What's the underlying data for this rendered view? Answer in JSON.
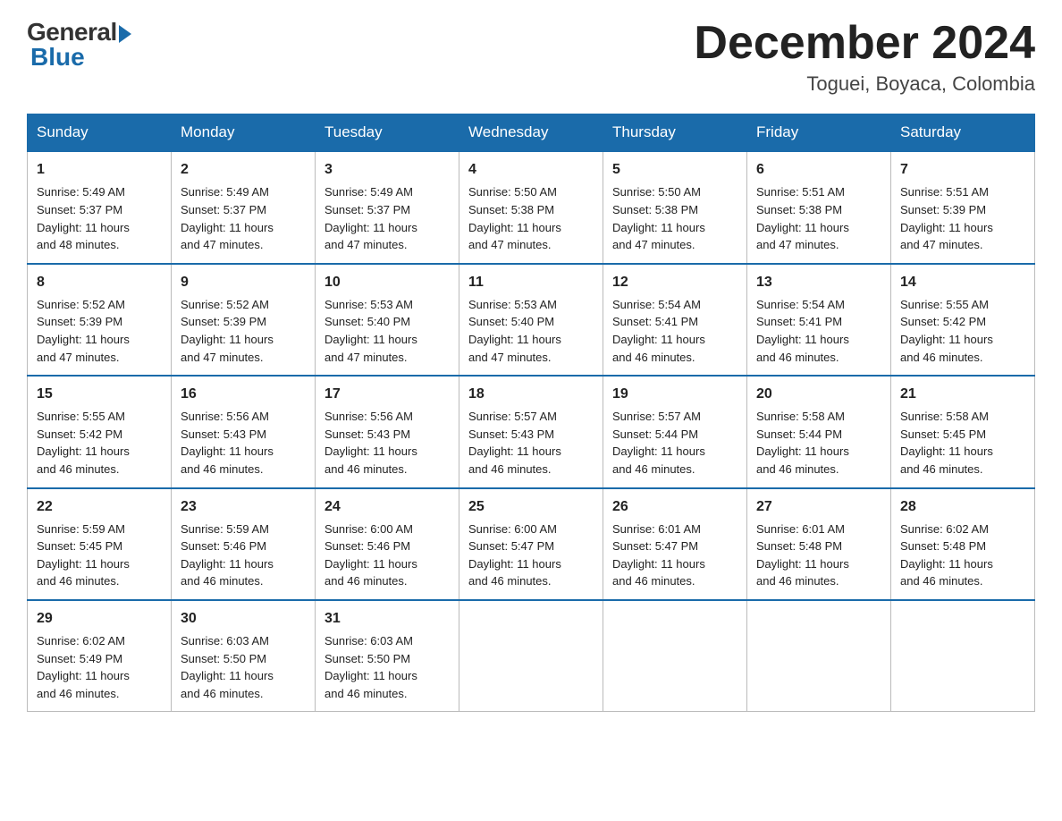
{
  "header": {
    "logo_general": "General",
    "logo_blue": "Blue",
    "month_title": "December 2024",
    "location": "Toguei, Boyaca, Colombia"
  },
  "days_of_week": [
    "Sunday",
    "Monday",
    "Tuesday",
    "Wednesday",
    "Thursday",
    "Friday",
    "Saturday"
  ],
  "weeks": [
    [
      {
        "day": "1",
        "sunrise": "5:49 AM",
        "sunset": "5:37 PM",
        "daylight": "11 hours and 48 minutes."
      },
      {
        "day": "2",
        "sunrise": "5:49 AM",
        "sunset": "5:37 PM",
        "daylight": "11 hours and 47 minutes."
      },
      {
        "day": "3",
        "sunrise": "5:49 AM",
        "sunset": "5:37 PM",
        "daylight": "11 hours and 47 minutes."
      },
      {
        "day": "4",
        "sunrise": "5:50 AM",
        "sunset": "5:38 PM",
        "daylight": "11 hours and 47 minutes."
      },
      {
        "day": "5",
        "sunrise": "5:50 AM",
        "sunset": "5:38 PM",
        "daylight": "11 hours and 47 minutes."
      },
      {
        "day": "6",
        "sunrise": "5:51 AM",
        "sunset": "5:38 PM",
        "daylight": "11 hours and 47 minutes."
      },
      {
        "day": "7",
        "sunrise": "5:51 AM",
        "sunset": "5:39 PM",
        "daylight": "11 hours and 47 minutes."
      }
    ],
    [
      {
        "day": "8",
        "sunrise": "5:52 AM",
        "sunset": "5:39 PM",
        "daylight": "11 hours and 47 minutes."
      },
      {
        "day": "9",
        "sunrise": "5:52 AM",
        "sunset": "5:39 PM",
        "daylight": "11 hours and 47 minutes."
      },
      {
        "day": "10",
        "sunrise": "5:53 AM",
        "sunset": "5:40 PM",
        "daylight": "11 hours and 47 minutes."
      },
      {
        "day": "11",
        "sunrise": "5:53 AM",
        "sunset": "5:40 PM",
        "daylight": "11 hours and 47 minutes."
      },
      {
        "day": "12",
        "sunrise": "5:54 AM",
        "sunset": "5:41 PM",
        "daylight": "11 hours and 46 minutes."
      },
      {
        "day": "13",
        "sunrise": "5:54 AM",
        "sunset": "5:41 PM",
        "daylight": "11 hours and 46 minutes."
      },
      {
        "day": "14",
        "sunrise": "5:55 AM",
        "sunset": "5:42 PM",
        "daylight": "11 hours and 46 minutes."
      }
    ],
    [
      {
        "day": "15",
        "sunrise": "5:55 AM",
        "sunset": "5:42 PM",
        "daylight": "11 hours and 46 minutes."
      },
      {
        "day": "16",
        "sunrise": "5:56 AM",
        "sunset": "5:43 PM",
        "daylight": "11 hours and 46 minutes."
      },
      {
        "day": "17",
        "sunrise": "5:56 AM",
        "sunset": "5:43 PM",
        "daylight": "11 hours and 46 minutes."
      },
      {
        "day": "18",
        "sunrise": "5:57 AM",
        "sunset": "5:43 PM",
        "daylight": "11 hours and 46 minutes."
      },
      {
        "day": "19",
        "sunrise": "5:57 AM",
        "sunset": "5:44 PM",
        "daylight": "11 hours and 46 minutes."
      },
      {
        "day": "20",
        "sunrise": "5:58 AM",
        "sunset": "5:44 PM",
        "daylight": "11 hours and 46 minutes."
      },
      {
        "day": "21",
        "sunrise": "5:58 AM",
        "sunset": "5:45 PM",
        "daylight": "11 hours and 46 minutes."
      }
    ],
    [
      {
        "day": "22",
        "sunrise": "5:59 AM",
        "sunset": "5:45 PM",
        "daylight": "11 hours and 46 minutes."
      },
      {
        "day": "23",
        "sunrise": "5:59 AM",
        "sunset": "5:46 PM",
        "daylight": "11 hours and 46 minutes."
      },
      {
        "day": "24",
        "sunrise": "6:00 AM",
        "sunset": "5:46 PM",
        "daylight": "11 hours and 46 minutes."
      },
      {
        "day": "25",
        "sunrise": "6:00 AM",
        "sunset": "5:47 PM",
        "daylight": "11 hours and 46 minutes."
      },
      {
        "day": "26",
        "sunrise": "6:01 AM",
        "sunset": "5:47 PM",
        "daylight": "11 hours and 46 minutes."
      },
      {
        "day": "27",
        "sunrise": "6:01 AM",
        "sunset": "5:48 PM",
        "daylight": "11 hours and 46 minutes."
      },
      {
        "day": "28",
        "sunrise": "6:02 AM",
        "sunset": "5:48 PM",
        "daylight": "11 hours and 46 minutes."
      }
    ],
    [
      {
        "day": "29",
        "sunrise": "6:02 AM",
        "sunset": "5:49 PM",
        "daylight": "11 hours and 46 minutes."
      },
      {
        "day": "30",
        "sunrise": "6:03 AM",
        "sunset": "5:50 PM",
        "daylight": "11 hours and 46 minutes."
      },
      {
        "day": "31",
        "sunrise": "6:03 AM",
        "sunset": "5:50 PM",
        "daylight": "11 hours and 46 minutes."
      },
      null,
      null,
      null,
      null
    ]
  ],
  "labels": {
    "sunrise": "Sunrise:",
    "sunset": "Sunset:",
    "daylight": "Daylight:"
  }
}
